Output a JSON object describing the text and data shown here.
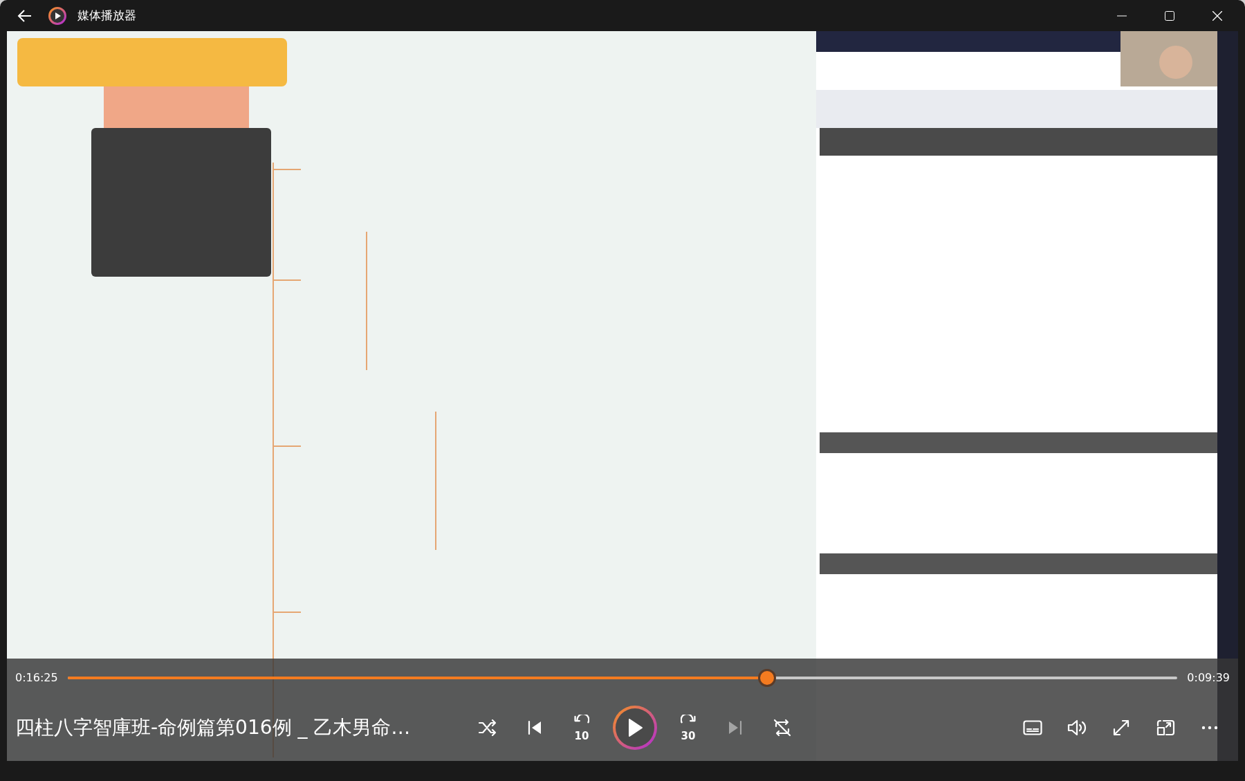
{
  "window": {
    "title": "媒体播放器"
  },
  "playback": {
    "elapsed": "0:16:25",
    "remaining": "0:09:39",
    "level": 0.63,
    "playing": false
  },
  "media_title": "四柱八字智庫班-命例篇第016例 _ 乙木男命…",
  "controls": [
    {
      "kind": "shuffle",
      "disabled": false
    },
    {
      "kind": "previous",
      "disabled": false
    },
    {
      "kind": "rewind",
      "label": "10",
      "disabled": false
    },
    {
      "kind": "play",
      "disabled": false
    },
    {
      "kind": "forward",
      "label": "30",
      "disabled": false
    },
    {
      "kind": "next",
      "disabled": true
    },
    {
      "kind": "repeat_off",
      "disabled": false
    }
  ],
  "side_controls": [
    {
      "kind": "subtitles"
    },
    {
      "kind": "volume"
    },
    {
      "kind": "fullscreen"
    },
    {
      "kind": "miniplayer"
    },
    {
      "kind": "more"
    }
  ]
}
